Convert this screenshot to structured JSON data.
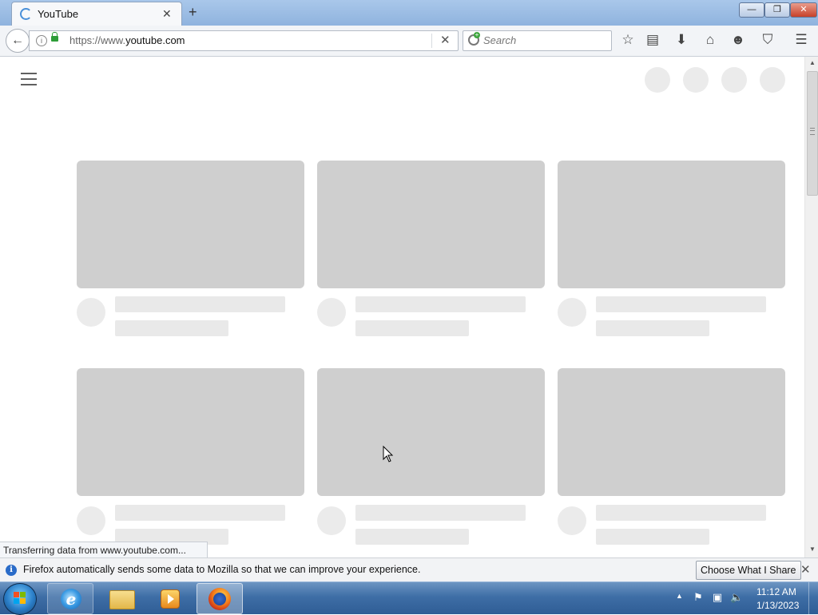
{
  "browser": {
    "tab_title": "YouTube",
    "url_prefix": "https://www.",
    "url_domain": "youtube.com",
    "search_placeholder": "Search",
    "status_text": "Transferring data from www.youtube.com...",
    "window_buttons": {
      "minimize": "—",
      "maximize": "❐",
      "close": "✕"
    }
  },
  "notification": {
    "text": "Firefox automatically sends some data to Mozilla so that we can improve your experience.",
    "button": "Choose What I Share"
  },
  "taskbar": {
    "time": "11:12 AM",
    "date": "1/13/2023",
    "ie_glyph": "e"
  },
  "colors": {
    "skeleton_thumb": "#cfcfcf",
    "skeleton_text": "#e9e9e9",
    "taskbar": "#3e6ea6"
  }
}
